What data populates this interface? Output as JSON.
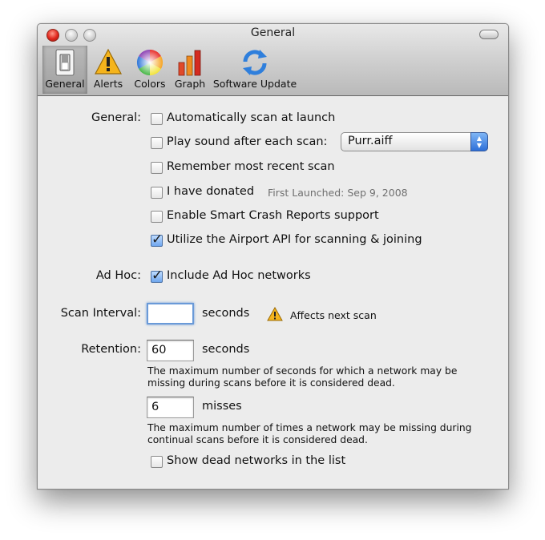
{
  "window": {
    "title": "General"
  },
  "toolbar": {
    "items": [
      {
        "label": "General",
        "icon": "light-switch-icon",
        "selected": true
      },
      {
        "label": "Alerts",
        "icon": "warning-icon"
      },
      {
        "label": "Colors",
        "icon": "color-wheel-icon"
      },
      {
        "label": "Graph",
        "icon": "bar-graph-icon"
      },
      {
        "label": "Software Update",
        "icon": "refresh-arrows-icon"
      }
    ]
  },
  "general": {
    "label": "General:",
    "options": [
      {
        "label": "Automatically scan at launch",
        "checked": false
      },
      {
        "label": "Play sound after each scan:",
        "checked": false
      },
      {
        "label": "Remember most recent scan",
        "checked": false
      },
      {
        "label": "I have donated",
        "checked": false
      },
      {
        "label": "Enable Smart Crash Reports support",
        "checked": false
      },
      {
        "label": "Utilize the Airport API for scanning & joining",
        "checked": true
      }
    ],
    "sound_popup_value": "Purr.aiff",
    "first_launched": "First Launched: Sep 9, 2008"
  },
  "adhoc": {
    "label": "Ad Hoc:",
    "option_label": "Include Ad Hoc networks",
    "checked": true
  },
  "scan_interval": {
    "label": "Scan Interval:",
    "value": "",
    "unit": "seconds",
    "warning": "Affects next scan"
  },
  "retention": {
    "label": "Retention:",
    "seconds_value": "60",
    "seconds_unit": "seconds",
    "seconds_help_line1": "The maximum number of seconds for which a network may be",
    "seconds_help_line2": "missing during scans before it is considered dead.",
    "misses_value": "6",
    "misses_unit": "misses",
    "misses_help_line1": "The maximum number of times a network may be missing during",
    "misses_help_line2": "continual scans before it is considered dead."
  },
  "show_dead": {
    "label": "Show dead networks in the list",
    "checked": false
  },
  "colors": {
    "accent": "#3b78d8",
    "warning": "#f2a20d"
  }
}
